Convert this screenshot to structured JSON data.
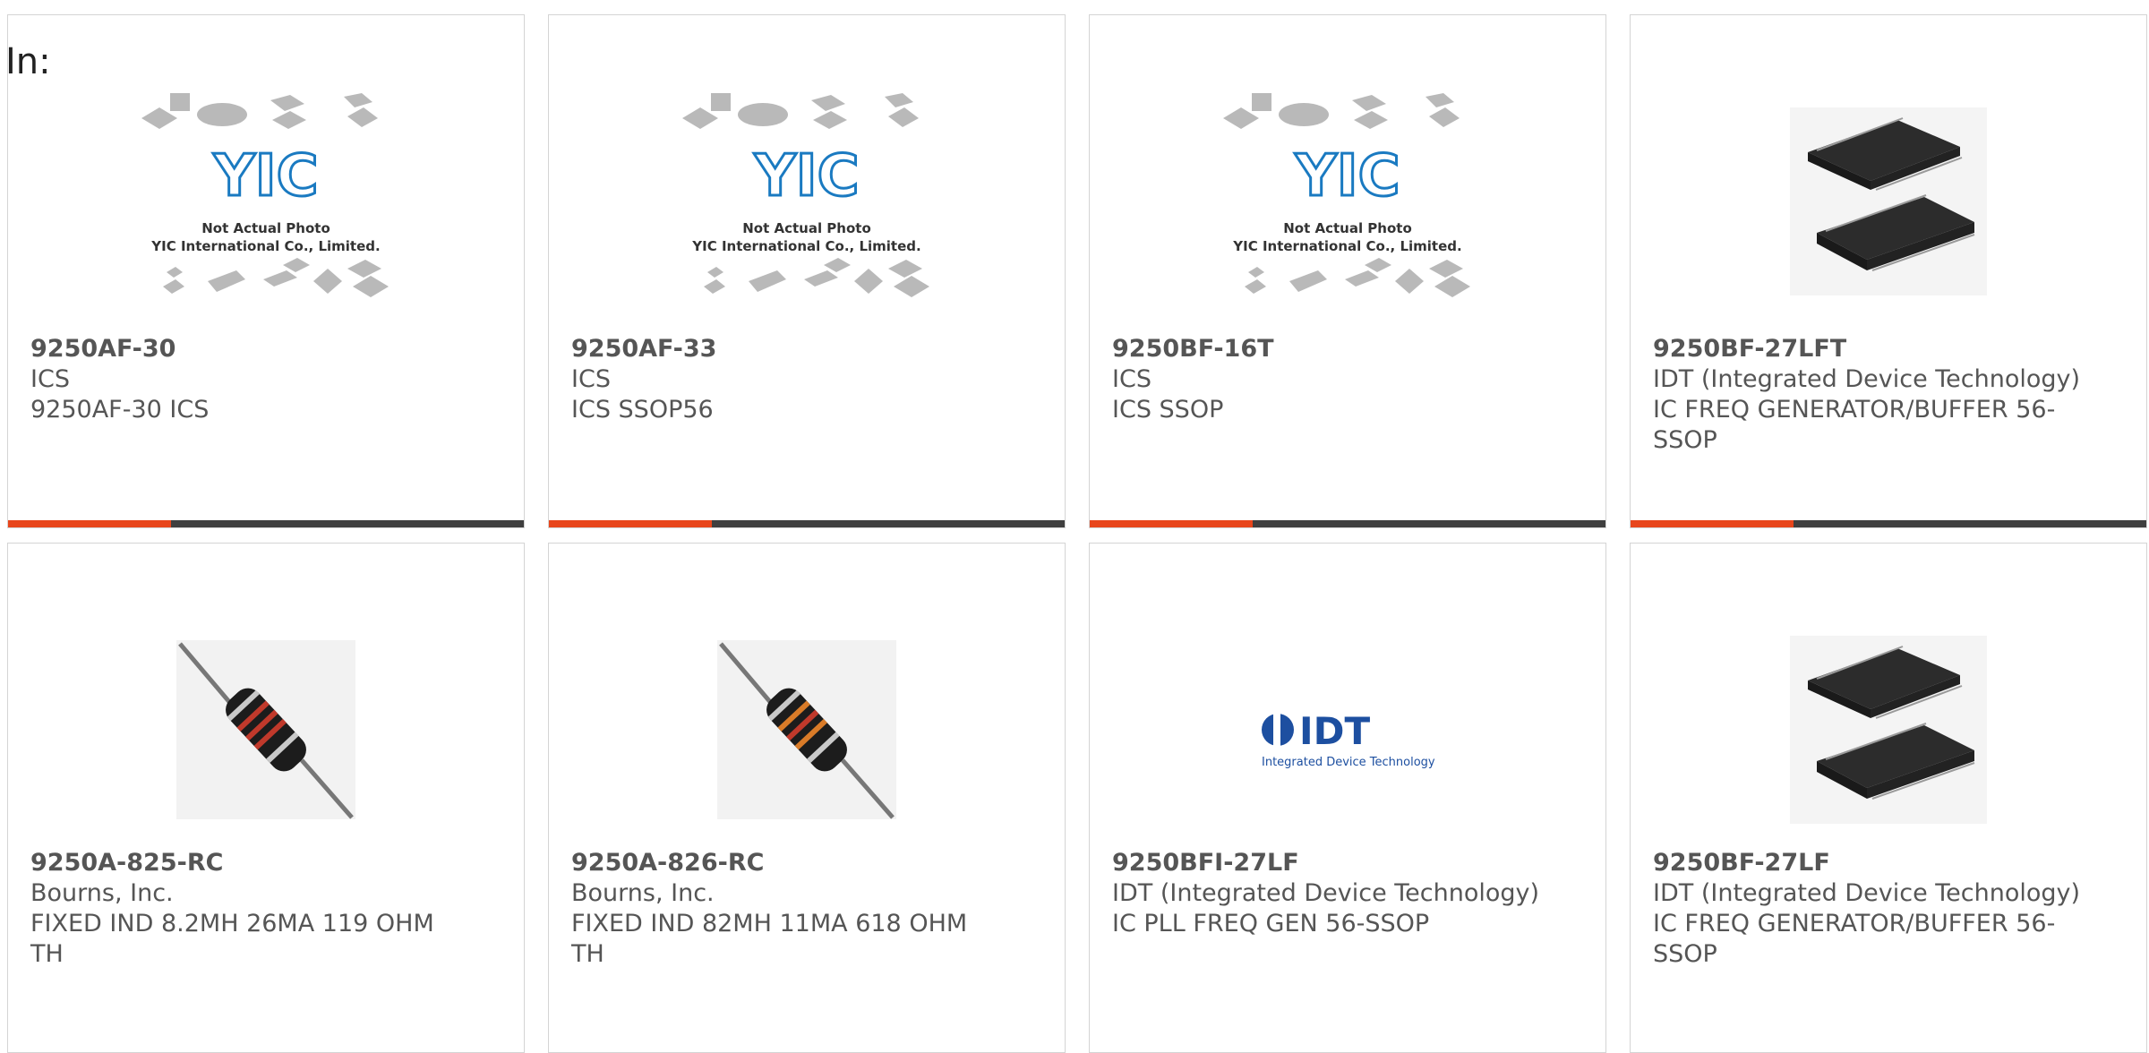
{
  "filter": {
    "label": "In:"
  },
  "placeholder": {
    "line1": "Not Actual Photo",
    "line2": "YIC International Co., Limited.",
    "logo": "YIC"
  },
  "idt_logo": {
    "mark": "IDT",
    "tagline": "Integrated Device Technology"
  },
  "colors": {
    "accent": "#e8461c",
    "bar": "#3f3f3f",
    "logo_blue": "#1d4fa0"
  },
  "products": [
    {
      "part": "9250AF-30",
      "mfr": "ICS",
      "desc": "9250AF-30 ICS",
      "image": "yic-placeholder"
    },
    {
      "part": "9250AF-33",
      "mfr": "ICS",
      "desc": "ICS SSOP56",
      "image": "yic-placeholder"
    },
    {
      "part": "9250BF-16T",
      "mfr": "ICS",
      "desc": "ICS SSOP",
      "image": "yic-placeholder"
    },
    {
      "part": "9250BF-27LFT",
      "mfr": "IDT (Integrated Device Technology)",
      "desc": "IC FREQ GENERATOR/BUFFER 56-SSOP",
      "image": "ssop-chip"
    },
    {
      "part": "9250A-825-RC",
      "mfr": "Bourns, Inc.",
      "desc": "FIXED IND 8.2MH 26MA 119 OHM TH",
      "image": "axial-inductor"
    },
    {
      "part": "9250A-826-RC",
      "mfr": "Bourns, Inc.",
      "desc": "FIXED IND 82MH 11MA 618 OHM TH",
      "image": "axial-inductor"
    },
    {
      "part": "9250BFI-27LF",
      "mfr": "IDT (Integrated Device Technology)",
      "desc": "IC PLL FREQ GEN 56-SSOP",
      "image": "idt-logo"
    },
    {
      "part": "9250BF-27LF",
      "mfr": "IDT (Integrated Device Technology)",
      "desc": "IC FREQ GENERATOR/BUFFER 56-SSOP",
      "image": "ssop-chip"
    }
  ]
}
